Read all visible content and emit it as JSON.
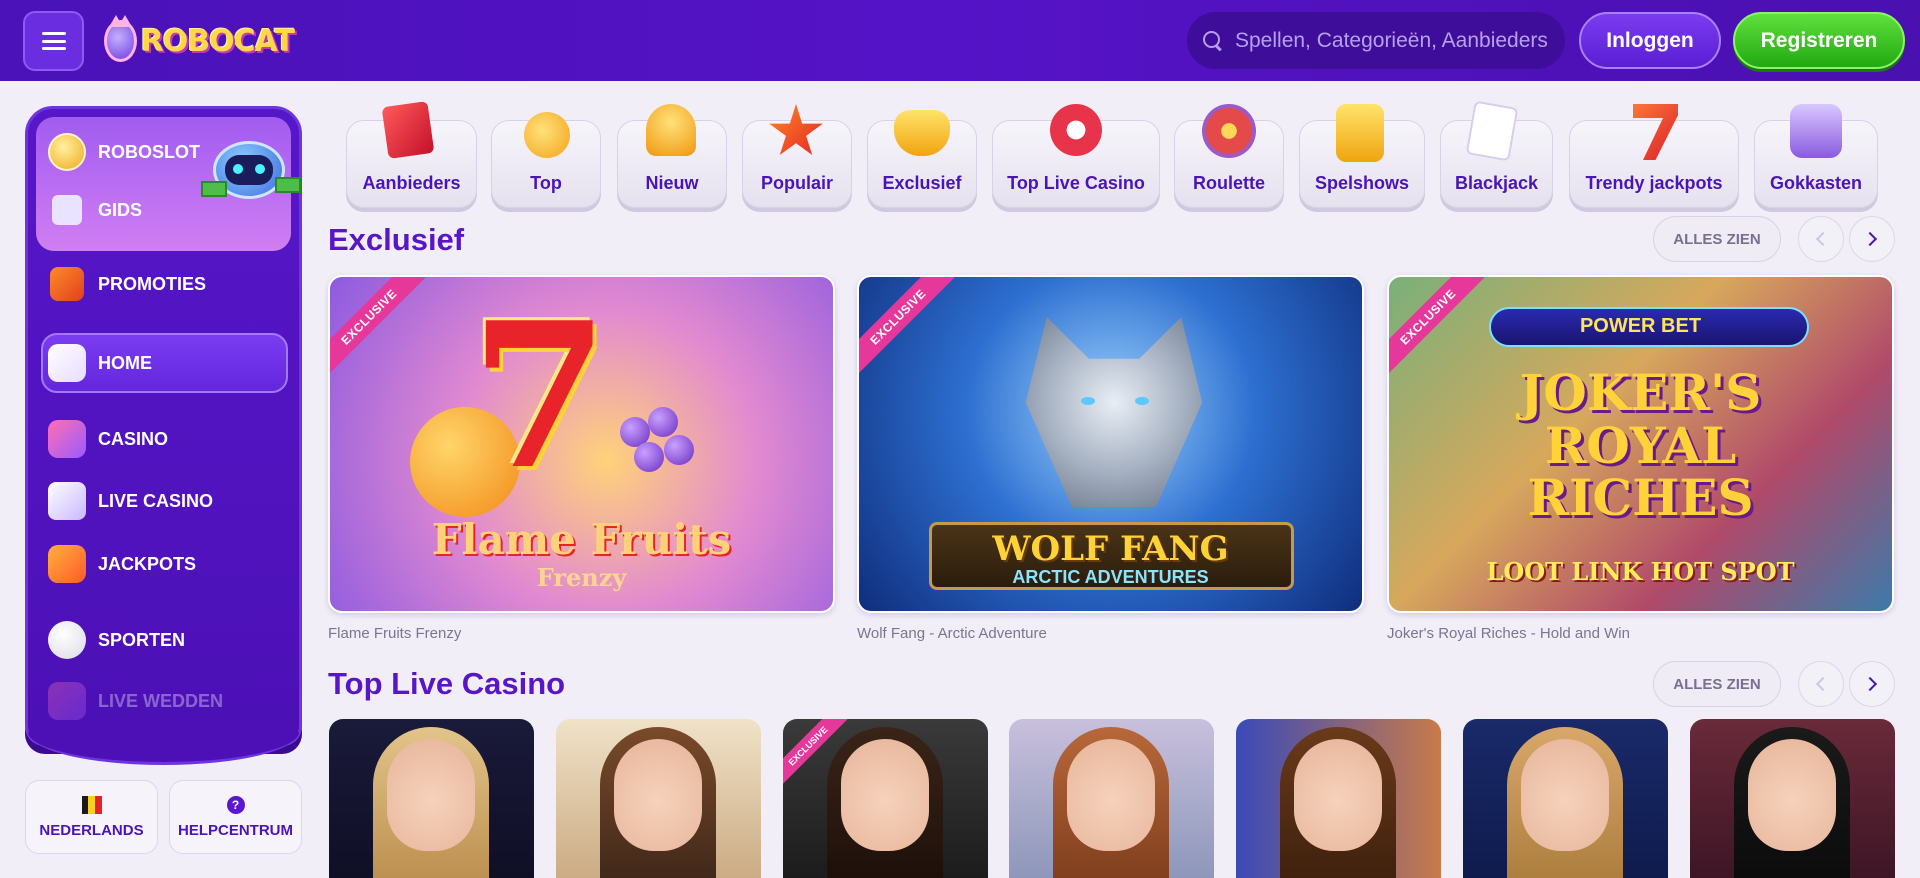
{
  "header": {
    "logo_text": "ROBOCAT",
    "search_placeholder": "Spellen, Categorieën, Aanbieders",
    "login_label": "Inloggen",
    "register_label": "Registreren"
  },
  "sidebar": {
    "items": [
      {
        "label": "ROBOSLOT",
        "icon": "coin-icon"
      },
      {
        "label": "GIDS",
        "icon": "map-icon"
      },
      {
        "label": "PROMOTIES",
        "icon": "gift-icon"
      },
      {
        "label": "HOME",
        "icon": "home-icon"
      },
      {
        "label": "CASINO",
        "icon": "slot-machine-icon"
      },
      {
        "label": "LIVE CASINO",
        "icon": "cards-icon"
      },
      {
        "label": "JACKPOTS",
        "icon": "lucky-seven-icon"
      },
      {
        "label": "SPORTEN",
        "icon": "football-icon"
      },
      {
        "label": "LIVE WEDDEN",
        "icon": "live-betting-icon"
      }
    ],
    "active": "HOME"
  },
  "footer_buttons": {
    "language_label": "NEDERLANDS",
    "help_label": "HELPCENTRUM",
    "help_glyph": "?"
  },
  "categories": [
    {
      "label": "Aanbieders",
      "icon": "providers-icon"
    },
    {
      "label": "Top",
      "icon": "medal-icon"
    },
    {
      "label": "Nieuw",
      "icon": "bell-icon"
    },
    {
      "label": "Populair",
      "icon": "star-icon"
    },
    {
      "label": "Exclusief",
      "icon": "gem-icon"
    },
    {
      "label": "Top Live Casino",
      "icon": "chip-icon"
    },
    {
      "label": "Roulette",
      "icon": "roulette-icon"
    },
    {
      "label": "Spelshows",
      "icon": "game-show-icon"
    },
    {
      "label": "Blackjack",
      "icon": "playing-cards-icon"
    },
    {
      "label": "Trendy jackpots",
      "icon": "jackpot-seven-icon"
    },
    {
      "label": "Gokkasten",
      "icon": "slot-777-icon"
    }
  ],
  "sections": {
    "exclusive": {
      "title": "Exclusief",
      "see_all": "ALLES ZIEN",
      "games": [
        {
          "name": "Flame Fruits Frenzy",
          "badge": "EXCLUSIVE",
          "art_text": "Flame Fruits",
          "art_sub": "Frenzy",
          "art_digit": "7"
        },
        {
          "name": "Wolf Fang - Arctic Adventure",
          "badge": "EXCLUSIVE",
          "art_text": "WOLF FANG",
          "art_sub": "ARCTIC ADVENTURES"
        },
        {
          "name": "Joker's Royal Riches - Hold and Win",
          "badge": "EXCLUSIVE",
          "art_pre": "POWER BET",
          "art_text": "JOKER'S ROYAL RICHES",
          "art_sub": "LOOT LINK HOT SPOT"
        }
      ]
    },
    "live_casino": {
      "title": "Top Live Casino",
      "see_all": "ALLES ZIEN",
      "tables": [
        {
          "badge": ""
        },
        {
          "badge": ""
        },
        {
          "badge": "EXCLUSIVE"
        },
        {
          "badge": ""
        },
        {
          "badge": ""
        },
        {
          "badge": ""
        },
        {
          "badge": ""
        }
      ]
    }
  },
  "colors": {
    "header_bg": "#4a12b8",
    "accent_purple": "#5816c8",
    "register_green": "#22a912",
    "exclusive_pink": "#e6389a",
    "page_bg": "#f1eef7"
  }
}
